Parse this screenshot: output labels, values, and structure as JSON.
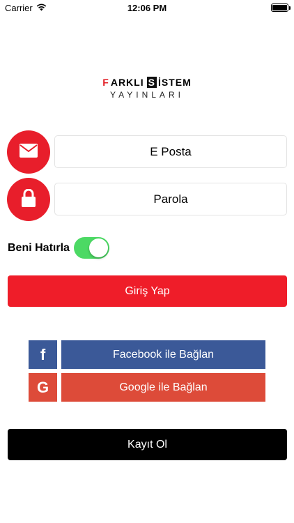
{
  "status_bar": {
    "carrier": "Carrier",
    "time": "12:06 PM"
  },
  "logo": {
    "top_first_letter": "F",
    "top_rest": "ARKLI",
    "top_highlight": "S",
    "top_end": "İSTEM",
    "bottom": "YAYINLARI"
  },
  "form": {
    "email_placeholder": "E Posta",
    "password_placeholder": "Parola",
    "remember_label": "Beni Hatırla",
    "remember_on": true,
    "login_label": "Giriş Yap"
  },
  "social": {
    "facebook_icon_glyph": "f",
    "facebook_label": "Facebook ile Bağlan",
    "google_icon_glyph": "G",
    "google_label": "Google ile Bağlan"
  },
  "register_label": "Kayıt Ol",
  "colors": {
    "primary_red": "#ef1d29",
    "facebook_blue": "#3b5998",
    "google_red": "#dd4b39",
    "toggle_green": "#4cd964"
  }
}
